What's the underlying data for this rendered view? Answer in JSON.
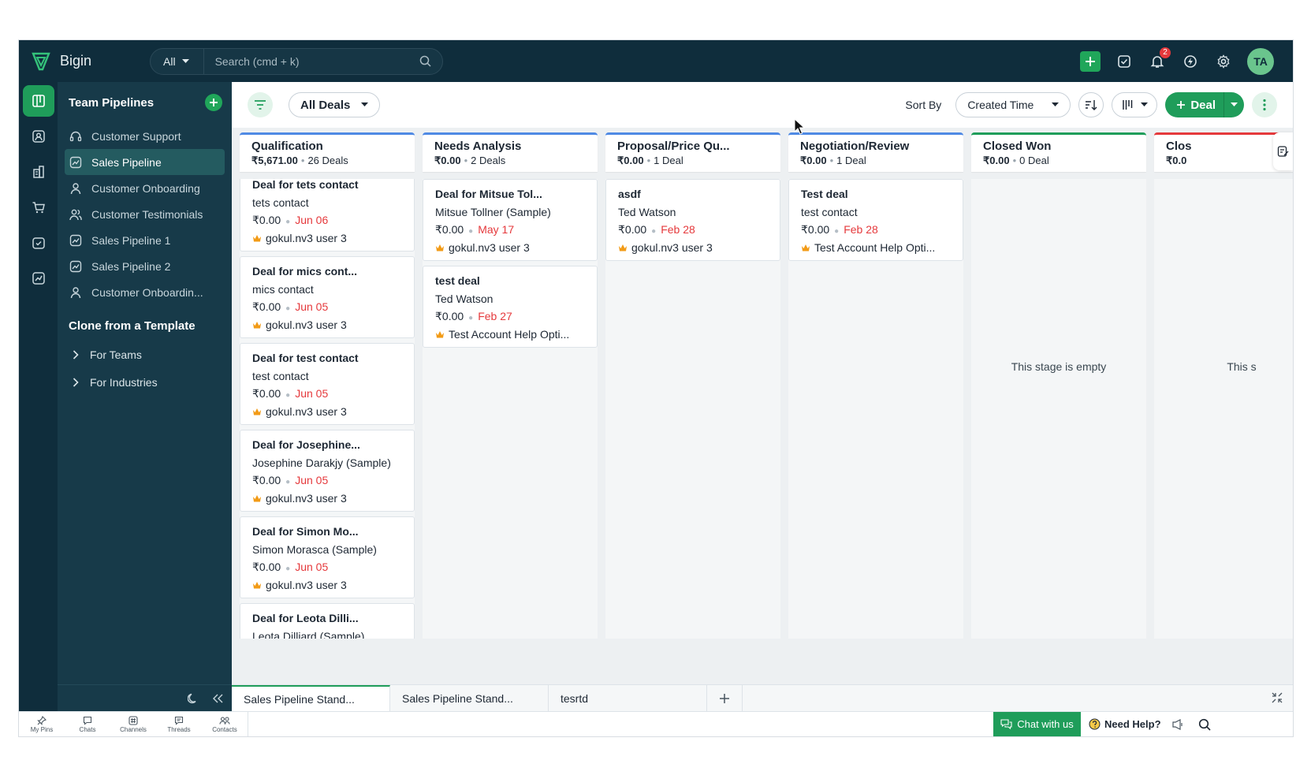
{
  "app": {
    "brand": "Bigin"
  },
  "search": {
    "scope": "All",
    "placeholder": "Search (cmd + k)"
  },
  "topbar": {
    "notification_count": "2",
    "avatar_initials": "TA"
  },
  "sidebar": {
    "title": "Team Pipelines",
    "items": [
      {
        "label": "Customer Support",
        "icon": "headset-icon"
      },
      {
        "label": "Sales Pipeline",
        "icon": "chart-icon"
      },
      {
        "label": "Customer Onboarding",
        "icon": "person-icon"
      },
      {
        "label": "Customer Testimonials",
        "icon": "people-icon"
      },
      {
        "label": "Sales Pipeline 1",
        "icon": "chart-icon"
      },
      {
        "label": "Sales Pipeline 2",
        "icon": "chart-icon"
      },
      {
        "label": "Customer Onboardin...",
        "icon": "person-icon"
      }
    ],
    "clone_title": "Clone from a Template",
    "clone_items": [
      "For Teams",
      "For Industries"
    ]
  },
  "toolbar": {
    "view": "All Deals",
    "sort_label": "Sort By",
    "sort_value": "Created Time",
    "deal_button": "Deal"
  },
  "columns": [
    {
      "name": "Qualification",
      "amount": "₹5,671.00",
      "count": "26 Deals",
      "accent": "#4f8ae4",
      "cards": [
        {
          "title": "Deal for tets contact",
          "contact": "tets contact",
          "amount": "₹0.00",
          "date": "Jun 06",
          "owner": "gokul.nv3 user 3"
        },
        {
          "title": "Deal for mics cont...",
          "contact": "mics contact",
          "amount": "₹0.00",
          "date": "Jun 05",
          "owner": "gokul.nv3 user 3"
        },
        {
          "title": "Deal for test contact",
          "contact": "test contact",
          "amount": "₹0.00",
          "date": "Jun 05",
          "owner": "gokul.nv3 user 3"
        },
        {
          "title": "Deal for Josephine...",
          "contact": "Josephine Darakjy (Sample)",
          "amount": "₹0.00",
          "date": "Jun 05",
          "owner": "gokul.nv3 user 3"
        },
        {
          "title": "Deal for Simon Mo...",
          "contact": "Simon Morasca (Sample)",
          "amount": "₹0.00",
          "date": "Jun 05",
          "owner": "gokul.nv3 user 3"
        },
        {
          "title": "Deal for Leota Dilli...",
          "contact": "Leota Dilliard (Sample)",
          "amount": "",
          "date": "",
          "owner": ""
        }
      ]
    },
    {
      "name": "Needs Analysis",
      "amount": "₹0.00",
      "count": "2 Deals",
      "accent": "#4f8ae4",
      "cards": [
        {
          "title": "Deal for Mitsue Tol...",
          "contact": "Mitsue Tollner (Sample)",
          "amount": "₹0.00",
          "date": "May 17",
          "owner": "gokul.nv3 user 3"
        },
        {
          "title": "test deal",
          "contact": "Ted Watson",
          "amount": "₹0.00",
          "date": "Feb 27",
          "owner": "Test Account Help Opti..."
        }
      ]
    },
    {
      "name": "Proposal/Price Qu...",
      "amount": "₹0.00",
      "count": "1 Deal",
      "accent": "#4f8ae4",
      "cards": [
        {
          "title": "asdf",
          "contact": "Ted Watson",
          "amount": "₹0.00",
          "date": "Feb 28",
          "owner": "gokul.nv3 user 3"
        }
      ]
    },
    {
      "name": "Negotiation/Review",
      "amount": "₹0.00",
      "count": "1 Deal",
      "accent": "#4f8ae4",
      "cards": [
        {
          "title": "Test deal",
          "contact": "test contact",
          "amount": "₹0.00",
          "date": "Feb 28",
          "owner": "Test Account Help Opti..."
        }
      ]
    },
    {
      "name": "Closed Won",
      "amount": "₹0.00",
      "count": "0 Deal",
      "accent": "#1f9d5a",
      "empty_text": "This stage is empty",
      "cards": []
    },
    {
      "name": "Clos",
      "amount": "₹0.0",
      "count": "",
      "accent": "#e5393c",
      "empty_text": "This s",
      "cards": []
    }
  ],
  "tabs": [
    "Sales Pipeline Stand...",
    "Sales Pipeline Stand...",
    "tesrtd"
  ],
  "bottom_nav": [
    "My Pins",
    "Chats",
    "Channels",
    "Threads",
    "Contacts"
  ],
  "chat_with_us": "Chat with us",
  "need_help": "Need Help?"
}
